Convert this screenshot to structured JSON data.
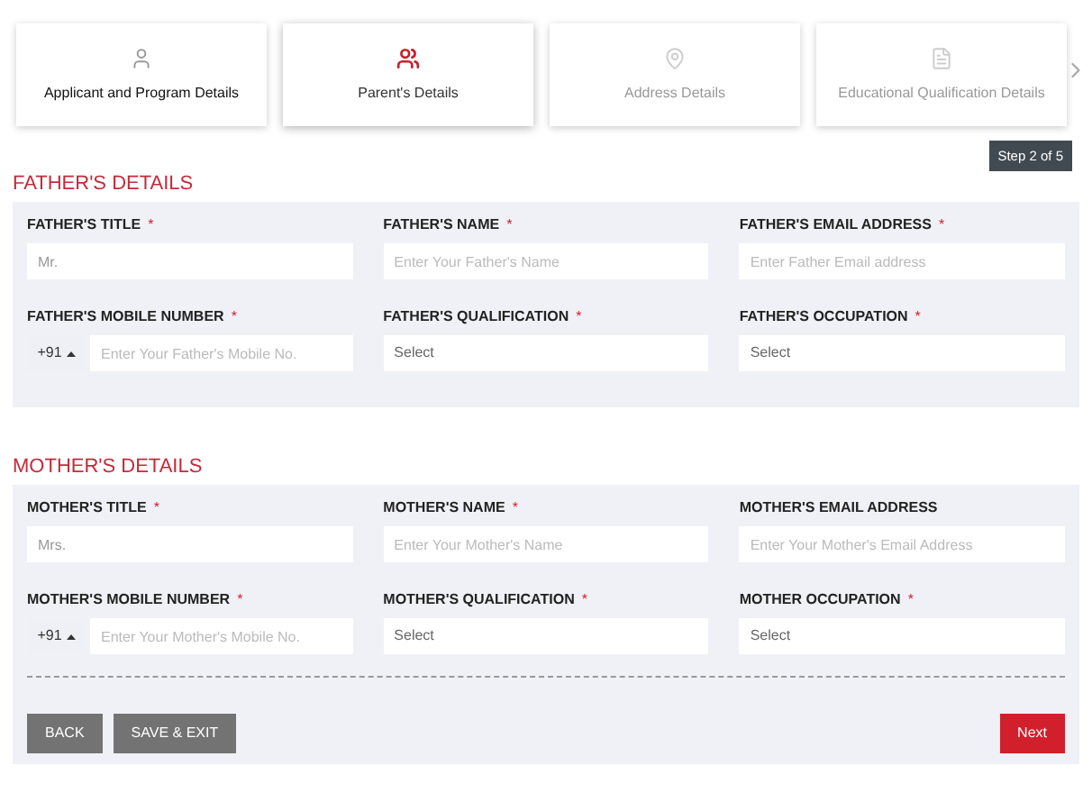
{
  "steps": [
    {
      "label": "Applicant and Program Details",
      "selected": false,
      "completed": true
    },
    {
      "label": "Parent's Details",
      "selected": true,
      "completed": false
    },
    {
      "label": "Address Details",
      "selected": false,
      "completed": false
    },
    {
      "label": "Educational Qualification Details",
      "selected": false,
      "completed": false
    }
  ],
  "step_badge": "Step 2 of 5",
  "sections": [
    {
      "title": "FATHER'S DETAILS",
      "fields": [
        {
          "label": "FATHER'S TITLE",
          "required_mark": "*",
          "kind": "text",
          "placeholder": "Mr."
        },
        {
          "label": "FATHER'S NAME",
          "required_mark": "*",
          "kind": "text",
          "placeholder": "Enter Your Father's Name"
        },
        {
          "label": "FATHER'S EMAIL ADDRESS",
          "required_mark": "*",
          "kind": "text",
          "placeholder": "Enter Father Email address"
        },
        {
          "label": "FATHER'S MOBILE NUMBER",
          "required_mark": "*",
          "kind": "phone",
          "code": "+91",
          "placeholder": "Enter Your Father's Mobile No."
        },
        {
          "label": "FATHER'S QUALIFICATION",
          "required_mark": "*",
          "kind": "select",
          "value": "Select"
        },
        {
          "label": "FATHER'S OCCUPATION",
          "required_mark": "*",
          "kind": "select",
          "value": "Select"
        }
      ]
    },
    {
      "title": "MOTHER'S DETAILS",
      "fields": [
        {
          "label": "MOTHER'S TITLE",
          "required_mark": "*",
          "kind": "text",
          "placeholder": "Mrs."
        },
        {
          "label": "MOTHER'S NAME",
          "required_mark": "*",
          "kind": "text",
          "placeholder": "Enter Your Mother's Name"
        },
        {
          "label": "MOTHER'S EMAIL ADDRESS",
          "kind": "text",
          "placeholder": "Enter Your Mother's Email Address"
        },
        {
          "label": "MOTHER'S MOBILE NUMBER",
          "required_mark": "*",
          "kind": "phone",
          "code": "+91",
          "placeholder": "Enter Your Mother's Mobile No."
        },
        {
          "label": "MOTHER'S QUALIFICATION",
          "required_mark": "*",
          "kind": "select",
          "value": "Select"
        },
        {
          "label": "MOTHER OCCUPATION",
          "required_mark": "*",
          "kind": "select",
          "value": "Select"
        }
      ]
    }
  ],
  "buttons": [
    {
      "label": "BACK",
      "kind": "secondary"
    },
    {
      "label": "SAVE & EXIT",
      "kind": "secondary"
    },
    {
      "label": "Next",
      "kind": "primary"
    }
  ]
}
